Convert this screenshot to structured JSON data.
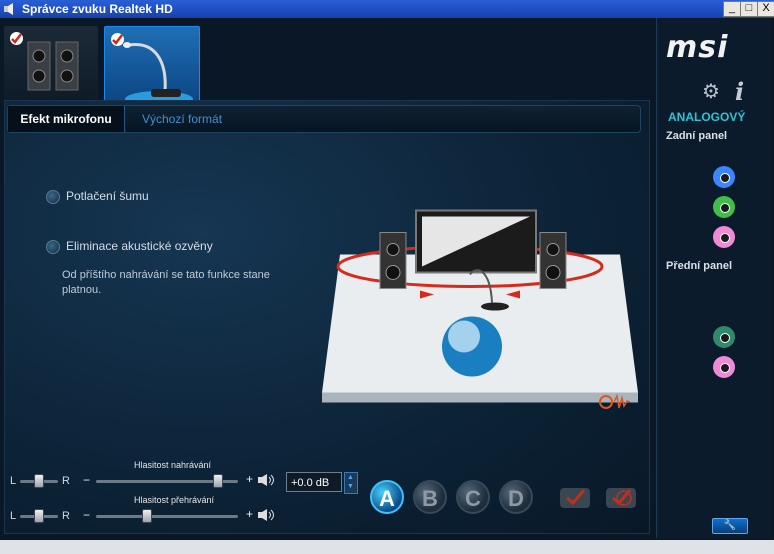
{
  "window": {
    "title": "Správce zvuku Realtek HD",
    "buttons": [
      "_",
      "□",
      "X"
    ]
  },
  "devices": [
    {
      "name": "speakers",
      "checked": true,
      "active": false
    },
    {
      "name": "microphone",
      "checked": true,
      "active": true
    }
  ],
  "tabs": {
    "active": "Efekt mikrofonu",
    "inactive": "Výchozí formát"
  },
  "options": {
    "noise": "Potlačení šumu",
    "echo": "Eliminace akustické ozvěny",
    "note": "Od příštího nahrávání se tato funkce stane platnou."
  },
  "sliders": {
    "recording": {
      "label": "Hlasitost nahrávání",
      "left": "L",
      "right": "R",
      "minus": "−",
      "plus": "+",
      "level": 0.85
    },
    "playback": {
      "label": "Hlasitost přehrávání",
      "left": "L",
      "right": "R",
      "minus": "−",
      "plus": "+",
      "level": 0.35
    },
    "db": "+0.0 dB"
  },
  "presets": [
    "A",
    "B",
    "C",
    "D"
  ],
  "right": {
    "logo": "msi",
    "analog": "ANALOGOVÝ",
    "rear": "Zadní panel",
    "front": "Přední panel",
    "jack_colors": {
      "blue": "#3b86ff",
      "green": "#3fbf4a",
      "pink": "#f08ad8",
      "teal": "#2f8a6a"
    }
  }
}
